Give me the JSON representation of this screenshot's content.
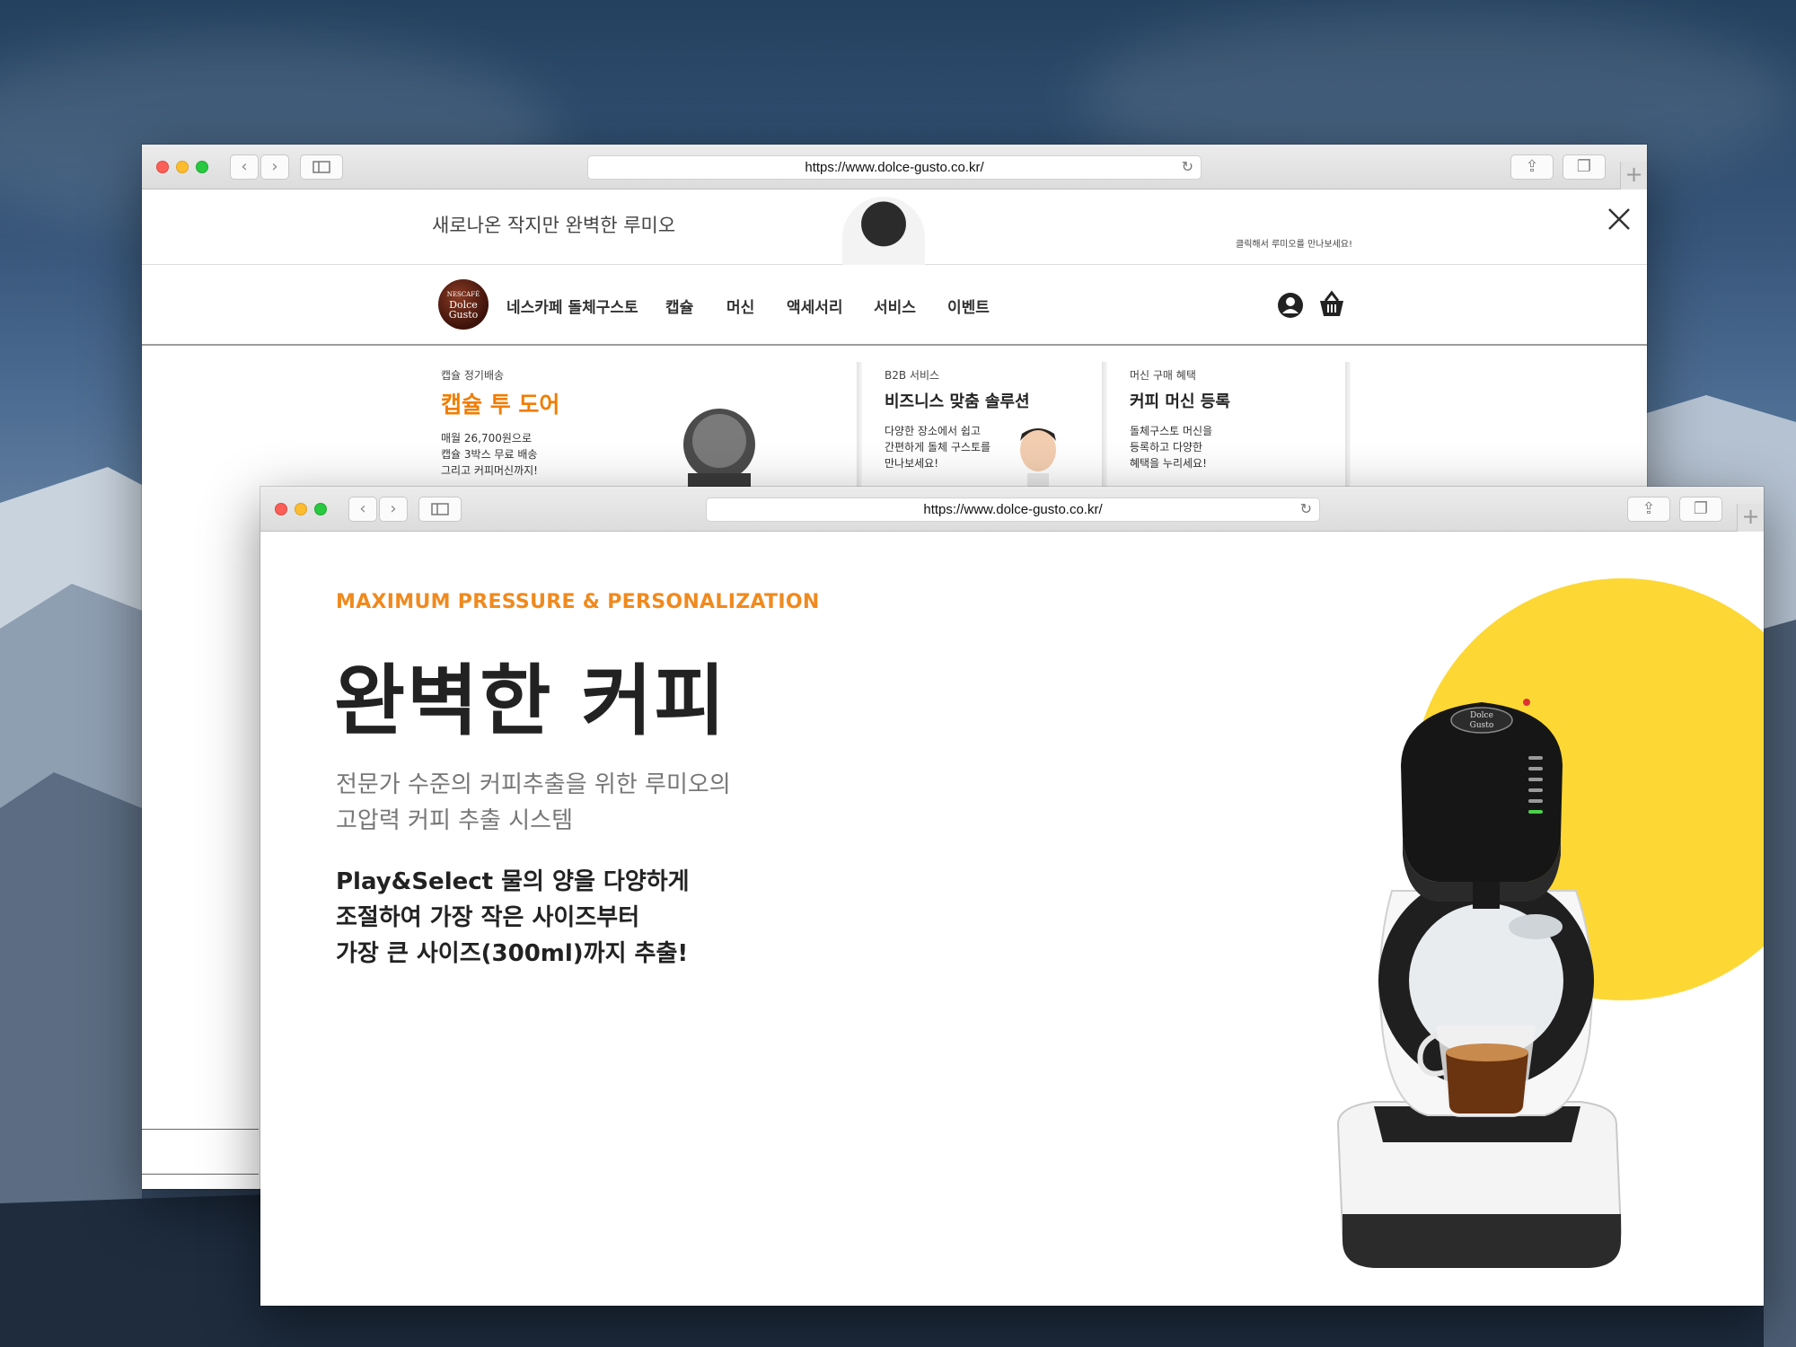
{
  "back_window": {
    "url": "https://www.dolce-gusto.co.kr/",
    "banner": {
      "title": "새로나온 작지만 완벽한 루미오",
      "cta": "클릭해서 루미오를 만나보세요!"
    },
    "nav": {
      "logo_text": [
        "NESCAFÉ",
        "Dolce",
        "Gusto"
      ],
      "items": [
        "네스카페 돌체구스토",
        "캡슐",
        "머신",
        "액세서리",
        "서비스",
        "이벤트"
      ]
    },
    "promos": [
      {
        "small": "캡슐 정기배송",
        "title": "캡슐 투 도어",
        "desc": [
          "매월 26,700원으로",
          "캡슐 3박스 무료 배송",
          "그리고 커피머신까지!"
        ]
      },
      {
        "small": "B2B 서비스",
        "title": "비즈니스 맞춤 솔루션",
        "desc": [
          "다양한 장소에서 쉽고",
          "간편하게 돌체 구스토를",
          "만나보세요!"
        ]
      },
      {
        "small": "머신 구매 혜택",
        "title": "커피 머신 등록",
        "desc": [
          "돌체구스토 머신을",
          "등록하고 다양한",
          "혜택을 누리세요!"
        ]
      }
    ]
  },
  "front_window": {
    "url": "https://www.dolce-gusto.co.kr/",
    "eyebrow": "MAXIMUM PRESSURE & PERSONALIZATION",
    "title": "완벽한 커피",
    "subtitle": [
      "전문가 수준의 커피추출을 위한 루미오의",
      "고압력 커피 추출 시스템"
    ],
    "body": [
      "Play&Select 물의 양을 다양하게",
      "조절하여 가장 작은 사이즈부터",
      "가장 큰 사이즈(300ml)까지 추출!"
    ],
    "product_logo": [
      "Dolce",
      "Gusto"
    ]
  },
  "colors": {
    "accent_orange": "#f08a1e",
    "promo_orange": "#f07d00",
    "circle_yellow": "#fdd835",
    "title_dark": "#222222"
  },
  "icons": [
    "back-icon",
    "forward-icon",
    "sidebar-icon",
    "reload-icon",
    "share-icon",
    "tabs-icon",
    "new-tab-icon",
    "close-icon",
    "user-icon",
    "basket-icon"
  ]
}
